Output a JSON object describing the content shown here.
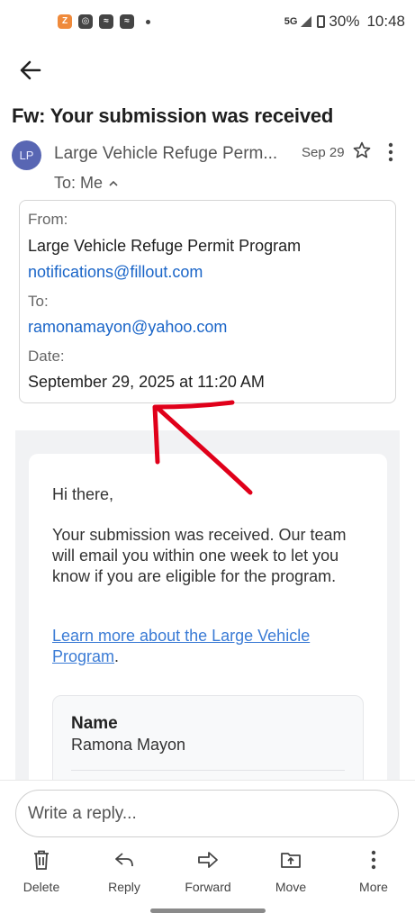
{
  "status_bar": {
    "notification_icons": [
      "zillow-icon",
      "signal-app-icon",
      "messenger-icon",
      "messenger-icon",
      "more-dot"
    ],
    "network": "5G",
    "battery": "30%",
    "time": "10:48"
  },
  "header": {
    "subject": "Fw: Your submission was received"
  },
  "sender": {
    "initials": "LP",
    "name": "Large Vehicle Refuge Perm...",
    "date": "Sep 29",
    "to_line": "To: Me"
  },
  "details": {
    "from_label": "From:",
    "from_name": "Large Vehicle Refuge Permit Program",
    "from_email": "notifications@fillout.com",
    "to_label": "To:",
    "to_email": "ramonamayon@yahoo.com",
    "date_label": "Date:",
    "date_value": "September 29, 2025 at 11:20 AM"
  },
  "body": {
    "greeting": "Hi there,",
    "paragraph": "Your submission was received. Our team will email you within one week to let you know if you are eligible for the program.",
    "link_text": "Learn more about the Large Vehicle Program",
    "link_suffix": ".",
    "field_label": "Name",
    "field_value": "Ramona Mayon"
  },
  "reply": {
    "placeholder": "Write a reply..."
  },
  "actions": {
    "delete": "Delete",
    "reply": "Reply",
    "forward": "Forward",
    "move": "Move",
    "more": "More"
  },
  "colors": {
    "avatar": "#5866b3",
    "link": "#1a65c8",
    "annotation": "#e0001a"
  }
}
